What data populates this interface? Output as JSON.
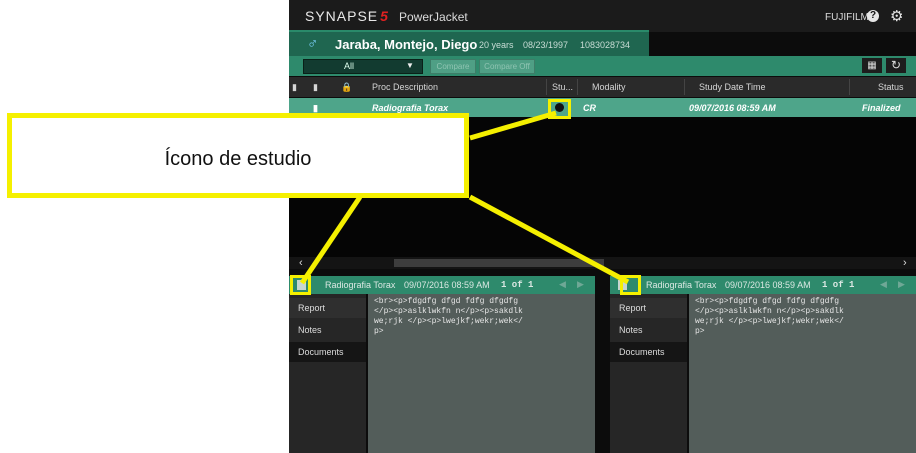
{
  "app": {
    "logo": "SYNAPSE",
    "logo_number": "5",
    "product": "PowerJacket",
    "vendor": "FUJIFILM",
    "help_icon": "help-icon",
    "settings_icon": "gear-icon"
  },
  "patient": {
    "gender_symbol": "♂",
    "name": "Jaraba, Montejo, Diego",
    "age": "20 years",
    "dob": "08/23/1997",
    "id": "1083028734"
  },
  "toolbar": {
    "filter_value": "All",
    "compare_label": "Compare",
    "compare_off_label": "Compare Off"
  },
  "columns": {
    "proc_description": "Proc Description",
    "study": "Stu...",
    "modality": "Modality",
    "study_date_time": "Study Date Time",
    "status": "Status"
  },
  "rows": [
    {
      "proc_description": "Radiografia Torax",
      "modality": "CR",
      "study_date_time": "09/07/2016 08:59 AM",
      "status": "Finalized"
    }
  ],
  "panes": [
    {
      "title": "Radiografia Torax",
      "date": "09/07/2016 08:59 AM",
      "pager": "1 of 1",
      "tabs": [
        "Report",
        "Notes",
        "Documents"
      ],
      "content": "<br><p>fdgdfg dfgd fdfg dfgdfg</p><p>aslklwkfn n</p><p>sakdlkwe;rjk </p><p>lwejkf;wekr;wek</p>"
    },
    {
      "title": "Radiografia Torax",
      "date": "09/07/2016 08:59 AM",
      "pager": "1 of 1",
      "tabs": [
        "Report",
        "Notes",
        "Documents"
      ],
      "content": "<br><p>fdgdfg dfgd fdfg dfgdfg</p><p>aslklwkfn n</p><p>sakdlkwe;rjk </p><p>lwejkf;wekr;wek</p>"
    }
  ],
  "annotation": {
    "label": "Ícono de estudio",
    "color": "#f5f000"
  }
}
